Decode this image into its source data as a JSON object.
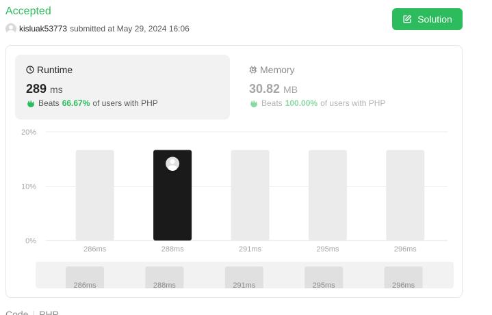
{
  "header": {
    "status": "Accepted",
    "username": "kisluak53773",
    "submitted_text": "submitted at May 29, 2024 16:06",
    "solution_label": "Solution"
  },
  "tabs": {
    "runtime": {
      "title": "Runtime",
      "value": "289",
      "unit": "ms",
      "beats_label": "Beats",
      "beats_pct": "66.67%",
      "beats_suffix": "of users with PHP"
    },
    "memory": {
      "title": "Memory",
      "value": "30.82",
      "unit": "MB",
      "beats_label": "Beats",
      "beats_pct": "100.00%",
      "beats_suffix": "of users with PHP"
    }
  },
  "colors": {
    "accent": "#2cbb5d",
    "bar": "#ebebeb",
    "bar_selected": "#1a1a1a"
  },
  "chart_data": {
    "type": "bar",
    "categories": [
      "286ms",
      "288ms",
      "291ms",
      "295ms",
      "296ms"
    ],
    "values": [
      16.67,
      16.67,
      16.67,
      16.67,
      16.67
    ],
    "highlighted": "288ms",
    "ylim": [
      0,
      20
    ],
    "yticks": [
      "0%",
      "10%",
      "20%"
    ],
    "ytick_values": [
      0,
      10,
      20
    ],
    "grid": true
  },
  "footer": {
    "code_label": "Code",
    "language": "PHP"
  }
}
